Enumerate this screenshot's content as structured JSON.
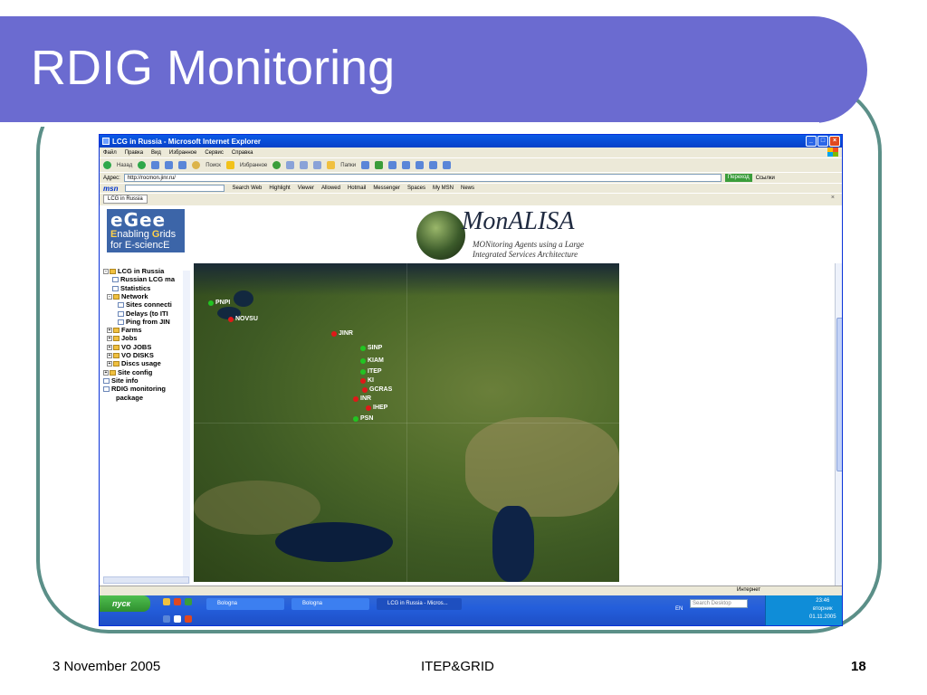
{
  "slide": {
    "title": "RDIG Monitoring",
    "footer_date": "3 November 2005",
    "footer_center": "ITEP&GRID",
    "page_number": "18",
    "colors": {
      "title_band": "#6b6bd0",
      "frame": "#5b8f88"
    }
  },
  "browser": {
    "window_title": "LCG in Russia - Microsoft Internet Explorer",
    "menu": [
      "Файл",
      "Правка",
      "Вид",
      "Избранное",
      "Сервис",
      "Справка"
    ],
    "toolbar": {
      "back": "Назад",
      "search": "Поиск",
      "favorites": "Избранное",
      "folders": "Папки"
    },
    "address_label": "Адрес:",
    "address_value": "http://rocmon.jinr.ru/",
    "go_label": "Переход",
    "links_label": "Ссылки",
    "msn": {
      "logo": "msn",
      "items": [
        "Search Web",
        "Highlight",
        "Viewer",
        "Allowed",
        "Hotmail",
        "Messenger",
        "Spaces",
        "My MSN",
        "News"
      ]
    },
    "tab_label": "LCG in Russia",
    "status_zone": "Интернет"
  },
  "page": {
    "egee": {
      "logo": "eGee",
      "line1_a": "E",
      "line1_b": "nabling ",
      "line1_c": "G",
      "line1_d": "rids",
      "line2": "for E-sciencE"
    },
    "monalisa": {
      "title": "MonALISA",
      "subtitle1": "MONitoring Agents using a Large",
      "subtitle2": "Integrated Services Architecture"
    },
    "tree": [
      {
        "label": "LCG in Russia",
        "icon": "folder-icon",
        "expander": "-"
      },
      {
        "label": "Russian LCG ma",
        "icon": "doc-icon"
      },
      {
        "label": "Statistics",
        "icon": "doc-icon"
      },
      {
        "label": "Network",
        "icon": "folder-icon",
        "expander": "-"
      },
      {
        "label": "Sites connecti",
        "icon": "doc-icon"
      },
      {
        "label": "Delays (to ITI",
        "icon": "doc-icon"
      },
      {
        "label": "Ping from JIN",
        "icon": "doc-icon"
      },
      {
        "label": "Farms",
        "icon": "folder-icon",
        "expander": "+"
      },
      {
        "label": "Jobs",
        "icon": "folder-icon",
        "expander": "+"
      },
      {
        "label": "VO JOBS",
        "icon": "folder-icon",
        "expander": "+"
      },
      {
        "label": "VO DISKS",
        "icon": "folder-icon",
        "expander": "+"
      },
      {
        "label": "Discs usage",
        "icon": "folder-icon",
        "expander": "+"
      },
      {
        "label": "Site config",
        "icon": "folder-icon",
        "expander": "+"
      },
      {
        "label": "Site info",
        "icon": "doc-icon"
      },
      {
        "label": "RDIG monitoring",
        "icon": "doc-icon"
      },
      {
        "label": "package",
        "icon": ""
      }
    ],
    "sites": [
      {
        "name": "PNPI",
        "status": "green"
      },
      {
        "name": "NOVSU",
        "status": "red"
      },
      {
        "name": "JINR",
        "status": "red"
      },
      {
        "name": "SINP",
        "status": "green"
      },
      {
        "name": "KIAM",
        "status": "green"
      },
      {
        "name": "ITEP",
        "status": "green"
      },
      {
        "name": "KI",
        "status": "red"
      },
      {
        "name": "GCRAS",
        "status": "red"
      },
      {
        "name": "INR",
        "status": "red"
      },
      {
        "name": "IHEP",
        "status": "red"
      },
      {
        "name": "PSN",
        "status": "green"
      }
    ],
    "status_colors": {
      "green": "#22c422",
      "red": "#e01818"
    }
  },
  "taskbar": {
    "start_label": "пуск",
    "buttons": [
      "Bologna",
      "Bologna",
      "LCG in Russia - Micros..."
    ],
    "lang": "EN",
    "search_placeholder": "Search Desktop",
    "time": "23:46",
    "day": "вторник",
    "date": "01.11.2005"
  }
}
